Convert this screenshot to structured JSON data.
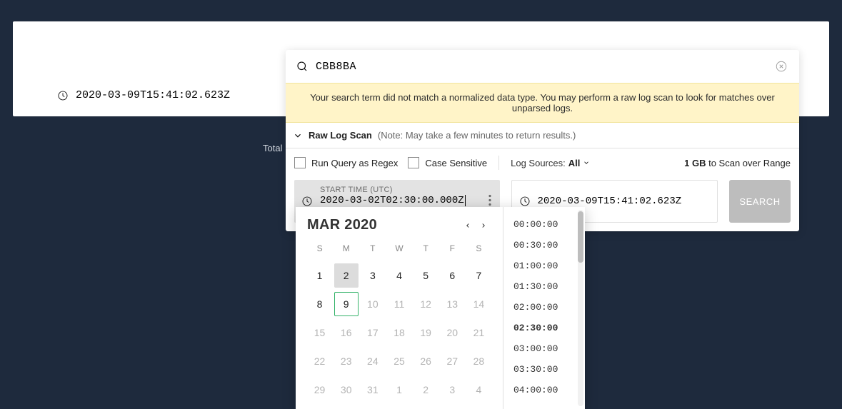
{
  "header": {
    "time_display": "2020-03-09T15:41:02.623Z"
  },
  "page": {
    "total_label": "Total L"
  },
  "search": {
    "term": "CBB8BA",
    "yellow_message": "Your search term did not match a normalized data type. You may perform a raw log scan to look for matches over unparsed logs."
  },
  "rawlog": {
    "title": "Raw Log Scan",
    "note": "(Note: May take a few minutes to return results.)"
  },
  "options": {
    "regex_label": "Run Query as Regex",
    "case_label": "Case Sensitive",
    "sources_label": "Log Sources:",
    "sources_value": "All",
    "scan_size": "1 GB",
    "scan_tail": "to Scan over Range"
  },
  "time": {
    "start_label": "START TIME (UTC)",
    "start_value": "2020-03-02T02:30:00.000Z",
    "start_hint": "2020-03-02T02:30:00.000Z",
    "end_value": "2020-03-09T15:41:02.623Z",
    "search_button": "SEARCH"
  },
  "calendar": {
    "title": "MAR 2020",
    "dow": [
      "S",
      "M",
      "T",
      "W",
      "T",
      "F",
      "S"
    ],
    "cells": [
      {
        "n": "1"
      },
      {
        "n": "2",
        "selected": true
      },
      {
        "n": "3"
      },
      {
        "n": "4"
      },
      {
        "n": "5"
      },
      {
        "n": "6"
      },
      {
        "n": "7"
      },
      {
        "n": "8"
      },
      {
        "n": "9",
        "today": true
      },
      {
        "n": "10",
        "out": true
      },
      {
        "n": "11",
        "out": true
      },
      {
        "n": "12",
        "out": true
      },
      {
        "n": "13",
        "out": true
      },
      {
        "n": "14",
        "out": true
      },
      {
        "n": "15",
        "out": true
      },
      {
        "n": "16",
        "out": true
      },
      {
        "n": "17",
        "out": true
      },
      {
        "n": "18",
        "out": true
      },
      {
        "n": "19",
        "out": true
      },
      {
        "n": "20",
        "out": true
      },
      {
        "n": "21",
        "out": true
      },
      {
        "n": "22",
        "out": true
      },
      {
        "n": "23",
        "out": true
      },
      {
        "n": "24",
        "out": true
      },
      {
        "n": "25",
        "out": true
      },
      {
        "n": "26",
        "out": true
      },
      {
        "n": "27",
        "out": true
      },
      {
        "n": "28",
        "out": true
      },
      {
        "n": "29",
        "out": true
      },
      {
        "n": "30",
        "out": true
      },
      {
        "n": "31",
        "out": true
      },
      {
        "n": "1",
        "out": true
      },
      {
        "n": "2",
        "out": true
      },
      {
        "n": "3",
        "out": true
      },
      {
        "n": "4",
        "out": true
      }
    ]
  },
  "time_slots": [
    {
      "t": "00:00:00"
    },
    {
      "t": "00:30:00"
    },
    {
      "t": "01:00:00"
    },
    {
      "t": "01:30:00"
    },
    {
      "t": "02:00:00"
    },
    {
      "t": "02:30:00",
      "selected": true
    },
    {
      "t": "03:00:00"
    },
    {
      "t": "03:30:00"
    },
    {
      "t": "04:00:00"
    }
  ]
}
